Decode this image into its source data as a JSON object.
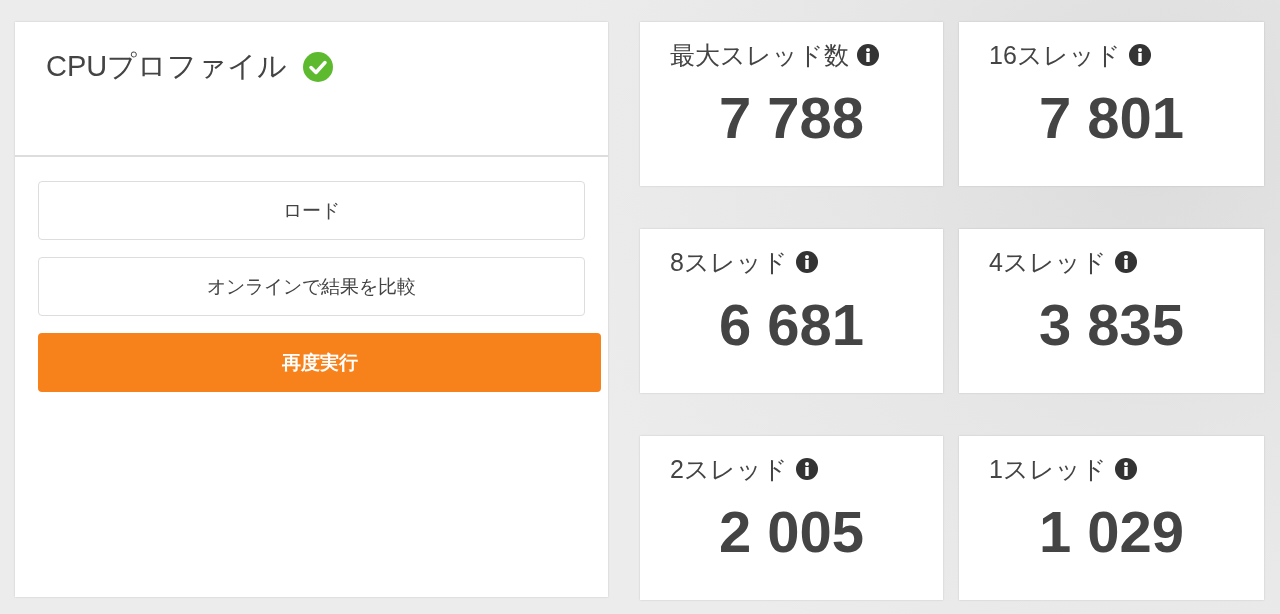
{
  "profile": {
    "title": "CPUプロファイル",
    "buttons": [
      {
        "label": "ロード",
        "kind": "outline"
      },
      {
        "label": "オンラインで結果を比較",
        "kind": "outline"
      },
      {
        "label": "再度実行",
        "kind": "primary"
      }
    ]
  },
  "scores": [
    {
      "label": "最大スレッド数",
      "value": "7 788"
    },
    {
      "label": "16スレッド",
      "value": "7 801"
    },
    {
      "label": "8スレッド",
      "value": "6 681"
    },
    {
      "label": "4スレッド",
      "value": "3 835"
    },
    {
      "label": "2スレッド",
      "value": "2 005"
    },
    {
      "label": "1スレッド",
      "value": "1 029"
    }
  ]
}
